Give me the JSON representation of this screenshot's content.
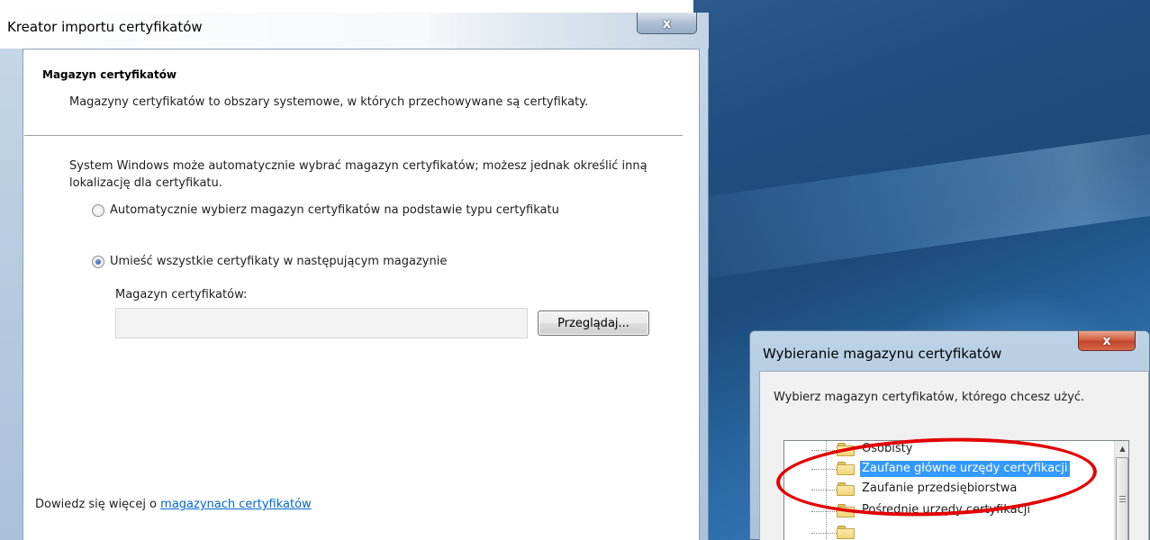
{
  "wizard": {
    "title": "Kreator importu certyfikatów",
    "close_label": "x",
    "section_heading": "Magazyn certyfikatów",
    "section_description": "Magazyny certyfikatów to obszary systemowe, w których przechowywane są certyfikaty.",
    "intro": "System Windows może automatycznie wybrać magazyn certyfikatów; możesz jednak określić inną lokalizację dla certyfikatu.",
    "options": [
      {
        "label": "Automatycznie wybierz magazyn certyfikatów na podstawie typu certyfikatu",
        "selected": false
      },
      {
        "label": "Umieść wszystkie certyfikaty w następującym magazynie",
        "selected": true
      }
    ],
    "store_field_label": "Magazyn certyfikatów:",
    "store_field_value": "",
    "browse_label": "Przeglądaj...",
    "learn_more_prefix": "Dowiedz się więcej o ",
    "learn_more_link": "magazynach certyfikatów"
  },
  "dialog": {
    "title": "Wybieranie magazynu certyfikatów",
    "close_label": "x",
    "prompt": "Wybierz magazyn certyfikatów, którego chcesz użyć.",
    "stores": [
      {
        "label": "Osobisty",
        "selected": false
      },
      {
        "label": "Zaufane główne urzędy certyfikacji",
        "selected": true
      },
      {
        "label": "Zaufanie przedsiębiorstwa",
        "selected": false
      },
      {
        "label": "Pośrednie urzędy certyfikacji",
        "selected": false
      }
    ]
  },
  "colors": {
    "selection": "#3399ff",
    "annotation": "#e30000",
    "link": "#0066cc"
  }
}
